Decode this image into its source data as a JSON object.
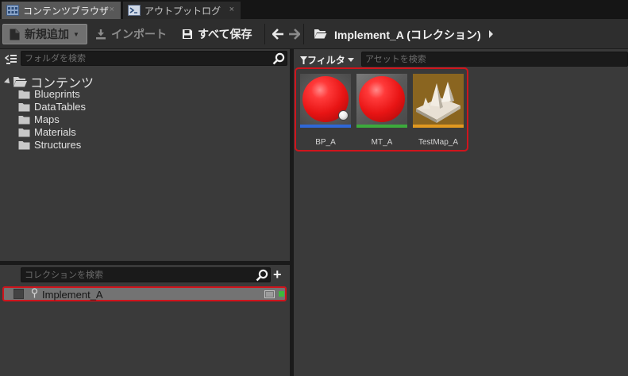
{
  "tabs": [
    {
      "label": "コンテンツブラウザ",
      "active": true,
      "close": "×"
    },
    {
      "label": "アウトプットログ",
      "active": false,
      "close": "×"
    }
  ],
  "toolbar": {
    "new_label": "新規追加",
    "import_label": "インポート",
    "saveall_label": "すべて保存",
    "path_label": "Implement_A (コレクション)"
  },
  "folders": {
    "search_placeholder": "フォルダを検索",
    "root_label": "コンテンツ",
    "items": [
      "Blueprints",
      "DataTables",
      "Maps",
      "Materials",
      "Structures"
    ]
  },
  "collections": {
    "search_placeholder": "コレクションを検索",
    "add_label": "+",
    "items": [
      {
        "label": "Implement_A"
      }
    ]
  },
  "assets_panel": {
    "filter_label": "フィルタ",
    "search_placeholder": "アセットを検索",
    "assets": [
      {
        "label": "BP_A",
        "type_color": "#2f67d6"
      },
      {
        "label": "MT_A",
        "type_color": "#3caa3c"
      },
      {
        "label": "TestMap_A",
        "type_color": "#e09820"
      }
    ]
  },
  "colors": {
    "highlight": "#d0141c",
    "collection_status": "#3dba3d"
  }
}
